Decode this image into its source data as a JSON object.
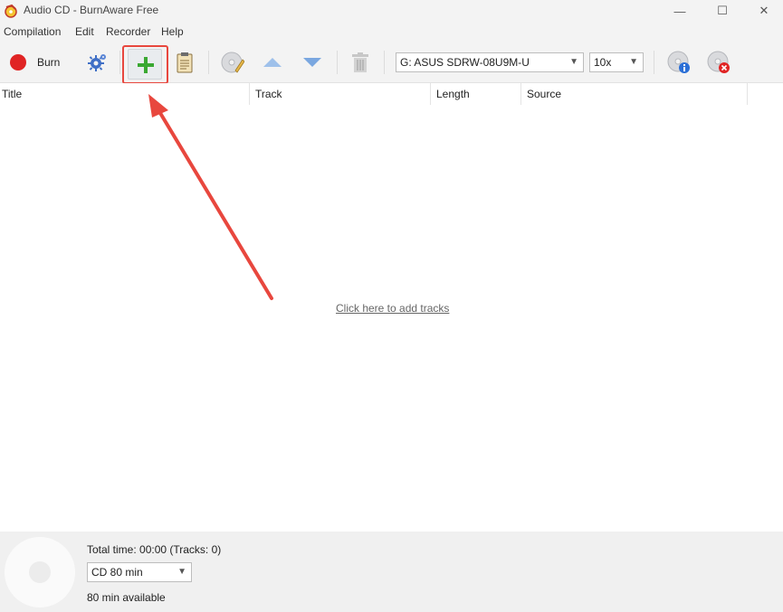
{
  "window": {
    "title": "Audio CD - BurnAware Free",
    "minimize": "—",
    "maximize": "☐",
    "close": "✕"
  },
  "menu": [
    "Compilation",
    "Edit",
    "Recorder",
    "Help"
  ],
  "toolbar": {
    "burn_label": "Burn",
    "icons": [
      "burn-icon",
      "settings-gear-icon",
      "add-plus-icon",
      "clipboard-icon",
      "disc-edit-icon",
      "move-up-icon",
      "move-down-icon",
      "trash-icon",
      "disc-info-icon",
      "disc-eject-icon"
    ],
    "drive_select": "G: ASUS SDRW-08U9M-U",
    "speed_select": "10x"
  },
  "columns": [
    "Title",
    "Track",
    "Length",
    "Source"
  ],
  "main": {
    "add_tracks_link": "Click here to add tracks"
  },
  "status": {
    "total_time": "Total time: 00:00 (Tracks: 0)",
    "disc_type": "CD 80 min",
    "available": "80 min available"
  },
  "colors": {
    "burn_red": "#e02424",
    "highlight_red": "#e8473e",
    "plus_green": "#3aa832",
    "arrow_blue": "#7aa7e0"
  }
}
